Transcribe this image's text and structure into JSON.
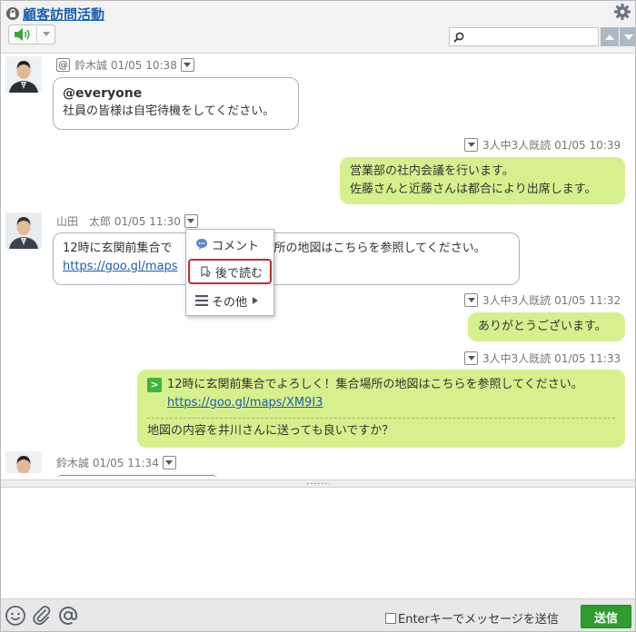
{
  "header": {
    "title": "顧客訪問活動",
    "search_placeholder": ""
  },
  "messages": [
    {
      "author": "鈴木誠",
      "time": "01/05 10:38",
      "mention": "@everyone",
      "text": "社員の皆様は自宅待機をしてください。"
    },
    {
      "read_status": "3人中3人既読",
      "time": "01/05 10:39",
      "line1": "営業部の社内会議を行います。",
      "line2": "佐藤さんと近藤さんは都合により出席します。"
    },
    {
      "author": "山田　太郎",
      "time": "01/05 11:30",
      "text_start": "12時に玄関前集合で",
      "text_end": "所の地図はこちらを参照してください。",
      "link": "https://goo.gl/maps"
    },
    {
      "read_status": "3人中3人既読",
      "time": "01/05 11:32",
      "text": "ありがとうございます。"
    },
    {
      "read_status": "3人中3人既読",
      "time": "01/05 11:33",
      "quote_text": "12時に玄関前集合でよろしく！集合場所の地図はこちらを参照してください。",
      "quote_link": "https://goo.gl/maps/XM9I3",
      "text": "地図の内容を井川さんに送っても良いですか？"
    },
    {
      "author": "鈴木誠",
      "time": "01/05 11:34"
    }
  ],
  "context_menu": {
    "comment": "コメント",
    "read_later": "後で読む",
    "other": "その他"
  },
  "footer": {
    "enter_label": "Enterキーでメッセージを送信",
    "send": "送信"
  },
  "colors": {
    "my_bubble": "#d6f08e",
    "accent_green": "#2e9d2e",
    "link_blue": "#1a5fae",
    "highlight_red": "#c62b2b"
  }
}
